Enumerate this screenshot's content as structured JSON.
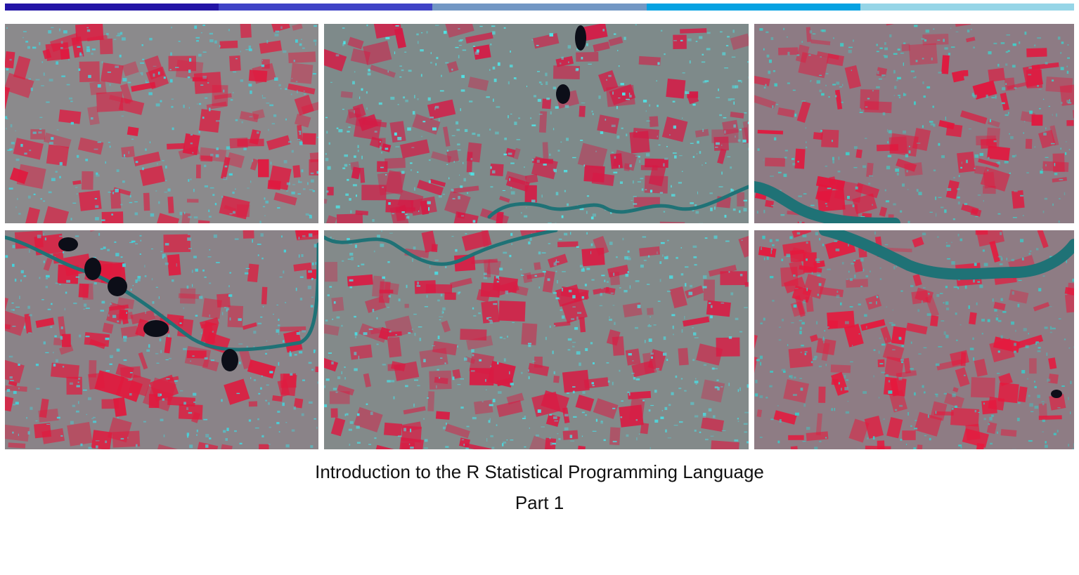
{
  "slide": {
    "title": "Introduction to the R Statistical Programming Language",
    "subtitle": "Part 1"
  },
  "header_bar": {
    "segments": [
      "#2315a6",
      "#3f43c6",
      "#7297c4",
      "#05a2e2",
      "#96d5e7"
    ]
  },
  "image": {
    "description_icon": "satellite-false-color-mosaic",
    "tiles": [
      {
        "id": "top-left",
        "palette": {
          "base": "#8b8a8c",
          "veg": "#e0193f",
          "urban": "#46d1da"
        }
      },
      {
        "id": "top-center",
        "palette": {
          "base": "#7e8a8a",
          "veg": "#d51a45",
          "urban": "#4fe3e6"
        }
      },
      {
        "id": "top-right",
        "palette": {
          "base": "#8d7b84",
          "veg": "#e3163d",
          "urban": "#3fcfc9"
        }
      },
      {
        "id": "bottom-left",
        "palette": {
          "base": "#8a8388",
          "veg": "#e01a3e",
          "urban": "#45d3dc"
        }
      },
      {
        "id": "bottom-center",
        "palette": {
          "base": "#838a8a",
          "veg": "#d91b43",
          "urban": "#4dd9df"
        }
      },
      {
        "id": "bottom-right",
        "palette": {
          "base": "#8e7c84",
          "veg": "#e6183d",
          "urban": "#3fc6c4"
        }
      }
    ],
    "water_color": "#1f7276",
    "lake_color": "#0c0e18"
  }
}
